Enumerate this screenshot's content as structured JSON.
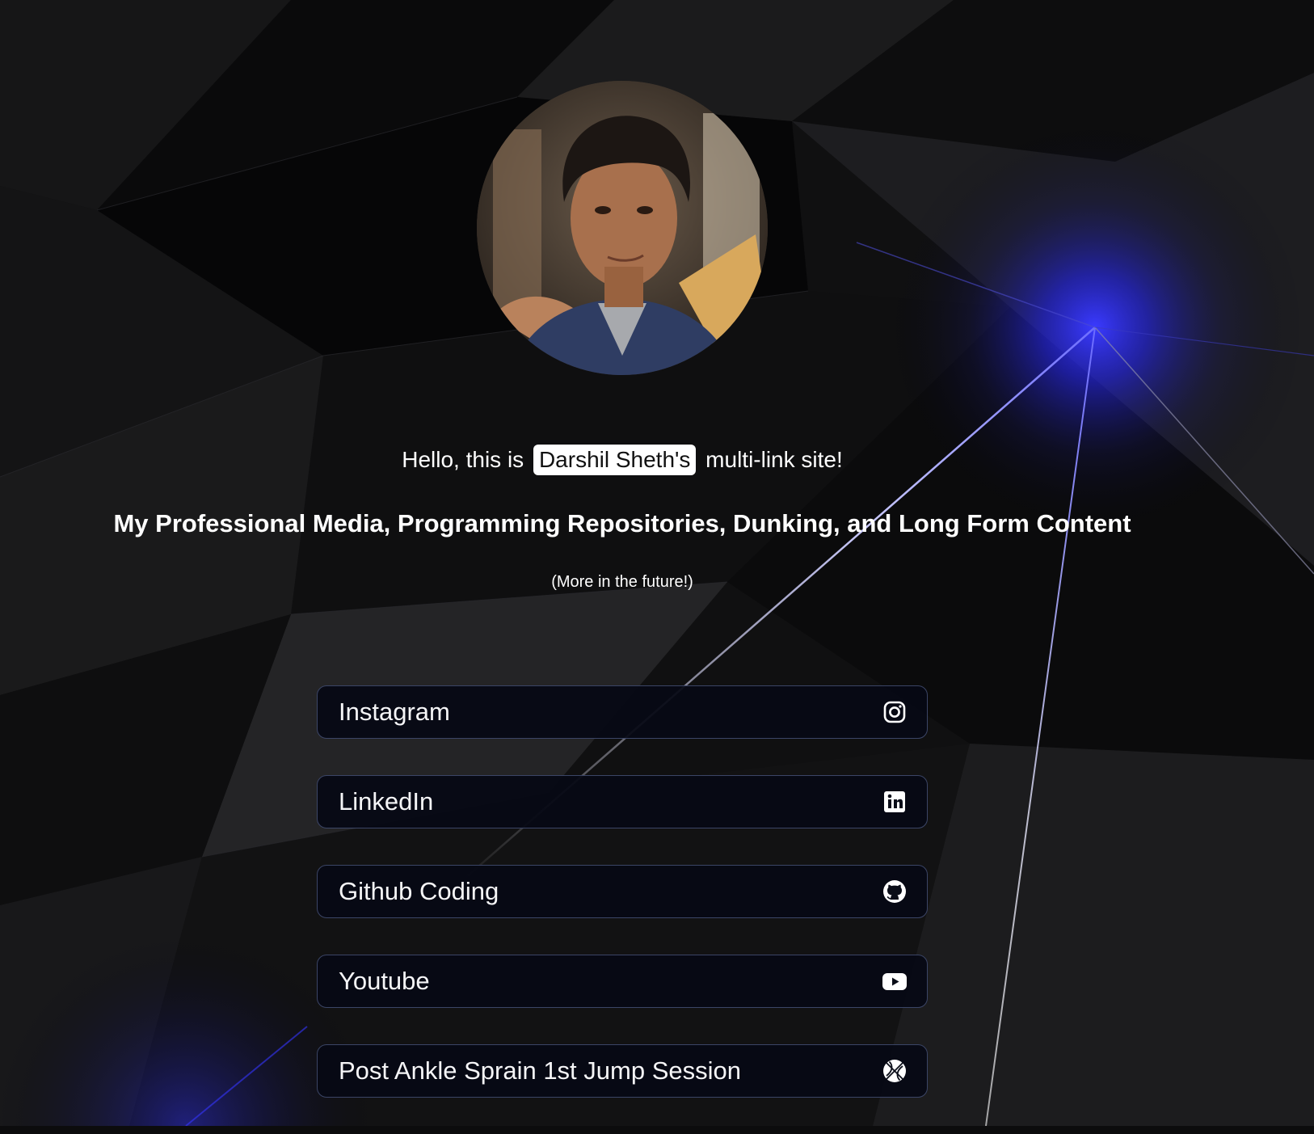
{
  "profile": {
    "avatar_alt": "Darshil Sheth profile photo"
  },
  "intro": {
    "before": "Hello, this is",
    "name": "Darshil Sheth's",
    "after": "multi-link site!"
  },
  "tagline": "My Professional Media, Programming Repositories, Dunking, and Long Form Content",
  "note": "(More in the future!)",
  "links": [
    {
      "label": "Instagram",
      "icon": "instagram-icon"
    },
    {
      "label": "LinkedIn",
      "icon": "linkedin-icon"
    },
    {
      "label": "Github Coding",
      "icon": "github-icon"
    },
    {
      "label": "Youtube",
      "icon": "youtube-icon"
    },
    {
      "label": "Post Ankle Sprain 1st Jump Session",
      "icon": "basketball-icon"
    }
  ],
  "colors": {
    "background": "#0c0c0d",
    "accent_glow": "#2323ff",
    "link_border": "#3b4566",
    "link_bg": "#060914",
    "name_highlight_bg": "#ffffff"
  }
}
